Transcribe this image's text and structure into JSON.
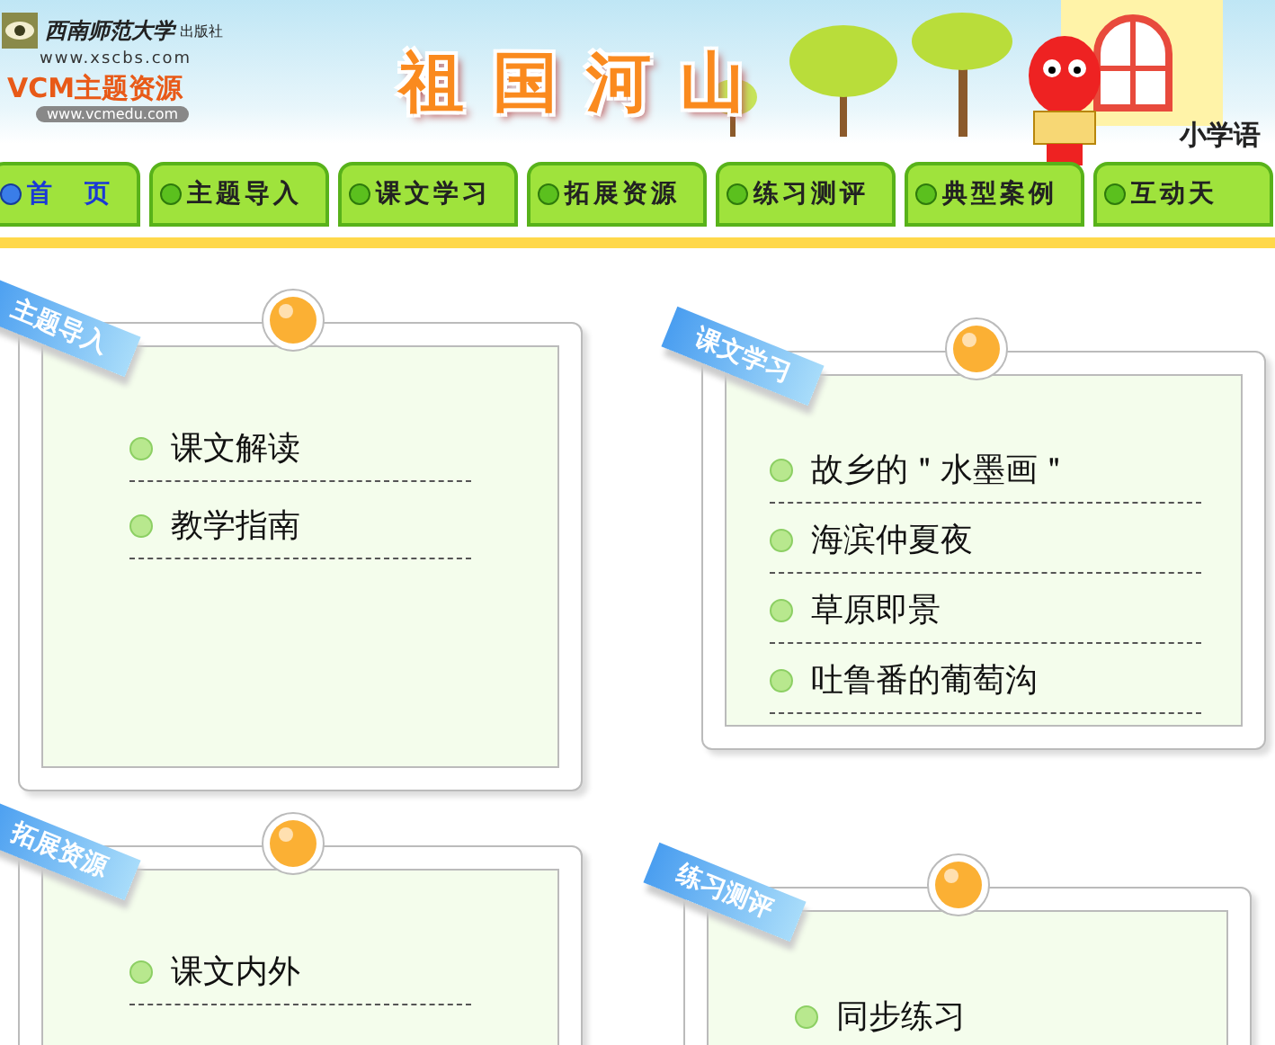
{
  "header": {
    "publisher": "西南师范大学",
    "publisher_suffix": "出版社",
    "publisher_url": "www.xscbs.com",
    "brand": "VCM主题资源",
    "brand_url": "www.vcmedu.com",
    "title": "祖国河山",
    "corner_text": "小学语"
  },
  "nav": [
    {
      "label": "首　页",
      "selected": true
    },
    {
      "label": "主题导入",
      "selected": false
    },
    {
      "label": "课文学习",
      "selected": false
    },
    {
      "label": "拓展资源",
      "selected": false
    },
    {
      "label": "练习测评",
      "selected": false
    },
    {
      "label": "典型案例",
      "selected": false
    },
    {
      "label": "互动天",
      "selected": false
    }
  ],
  "cards": [
    {
      "ribbon": "主题导入",
      "items": [
        "课文解读",
        "教学指南"
      ]
    },
    {
      "ribbon": "课文学习",
      "items": [
        "故乡的＂水墨画＂",
        "海滨仲夏夜",
        "草原即景",
        "吐鲁番的葡萄沟"
      ]
    },
    {
      "ribbon": "拓展资源",
      "items": [
        "课文内外"
      ]
    },
    {
      "ribbon": "练习测评",
      "items": [
        "同步练习"
      ]
    }
  ]
}
